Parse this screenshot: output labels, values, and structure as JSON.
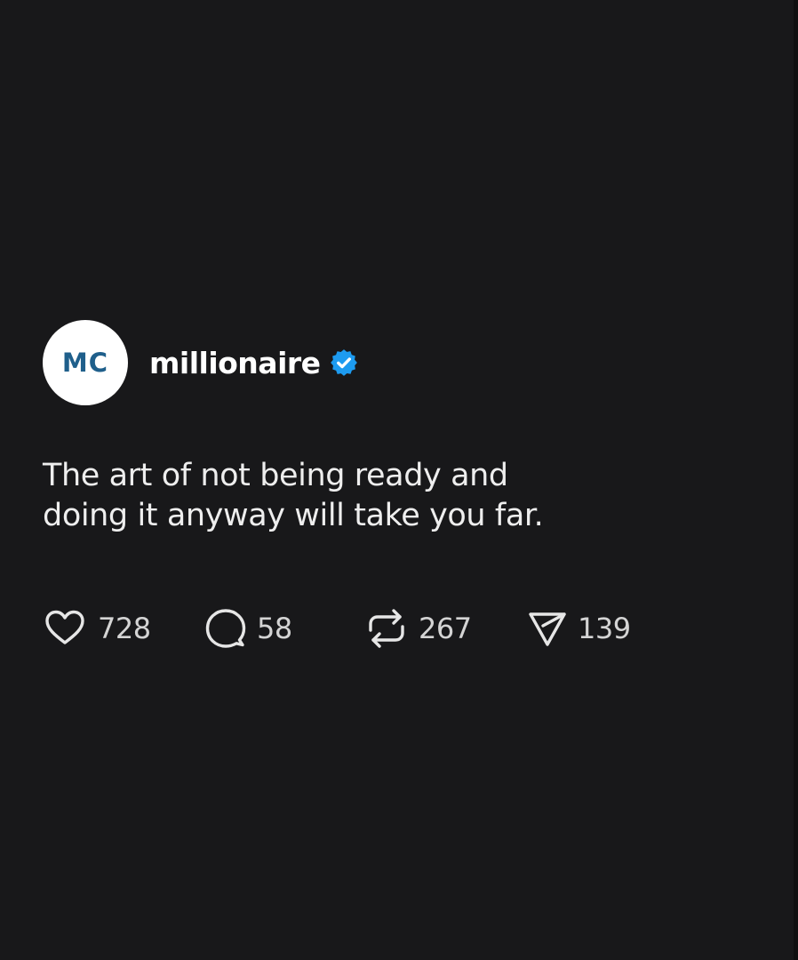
{
  "post": {
    "avatar_initials": "MC",
    "username": "millionaire",
    "verified": true,
    "text": "The art of not being ready and doing it anyway will take you far.",
    "actions": {
      "likes": "728",
      "replies": "58",
      "reposts": "267",
      "shares": "139"
    },
    "icons": {
      "like": "heart-icon",
      "reply": "speech-bubble-icon",
      "repost": "repost-arrows-icon",
      "share": "paper-plane-icon",
      "verified": "verified-badge-icon"
    }
  },
  "colors": {
    "background": "#18181a",
    "text": "#f2f2f2",
    "verified_badge": "#1d9bf0",
    "avatar_background": "#ffffff",
    "avatar_text": "#1f5f8b"
  }
}
